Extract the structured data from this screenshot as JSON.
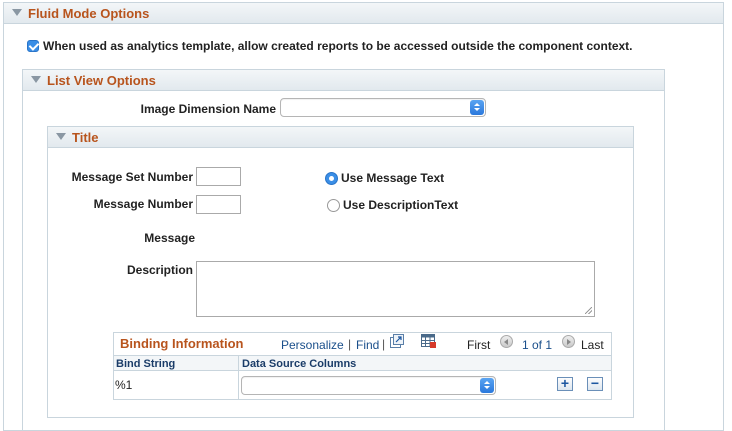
{
  "fluid": {
    "title": "Fluid Mode Options",
    "analytics_label": "When used as analytics template, allow created reports to be accessed outside the component context."
  },
  "listview": {
    "title": "List View Options",
    "image_dimension_label": "Image Dimension Name",
    "image_dimension_value": ""
  },
  "title_section": {
    "title": "Title",
    "msg_set_label": "Message Set Number",
    "msg_set_value": "",
    "msg_num_label": "Message Number",
    "msg_num_value": "",
    "message_label": "Message",
    "description_label": "Description",
    "description_value": "",
    "radio_use_message": "Use Message Text",
    "radio_use_desc": "Use DescriptionText",
    "selected_radio": "Use Message Text"
  },
  "binding": {
    "title": "Binding Information",
    "personalize": "Personalize",
    "sep": "|",
    "find": "Find",
    "first": "First",
    "range": "1 of 1",
    "last": "Last",
    "col_bind": "Bind String",
    "col_source": "Data Source Columns",
    "rows": [
      {
        "bind_string": "%1",
        "data_source": ""
      }
    ]
  },
  "colors": {
    "section_title": "#b8541d",
    "link": "#1a4f8b",
    "accent": "#3a8ee6",
    "border": "#c9d5dd"
  }
}
